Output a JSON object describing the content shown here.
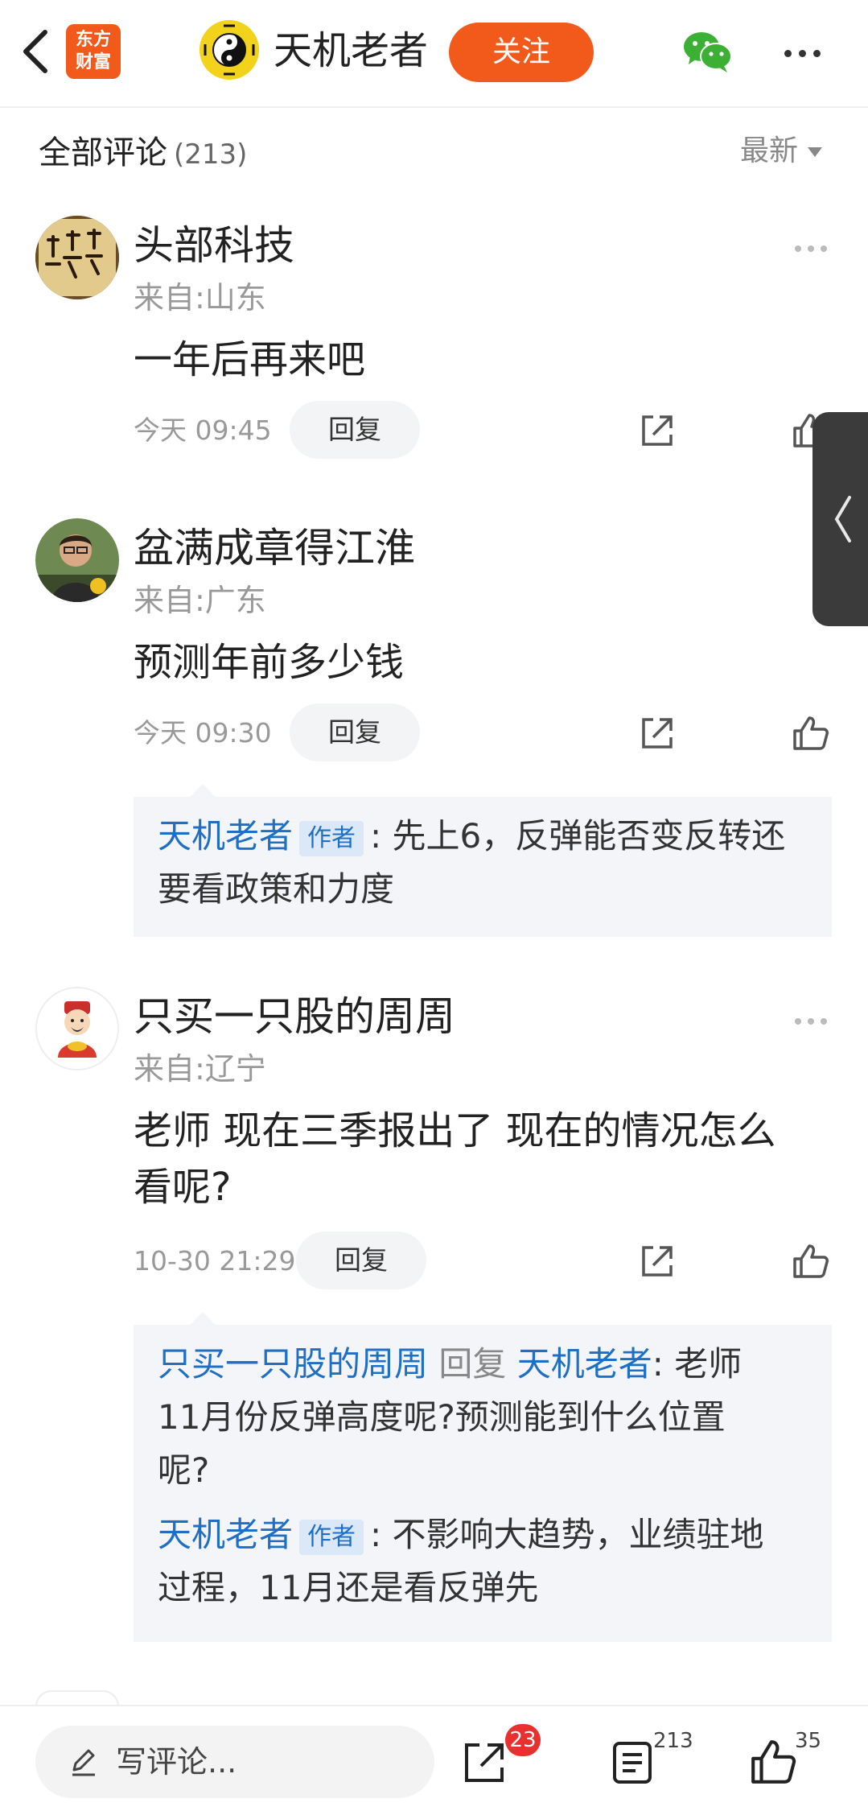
{
  "header": {
    "logo_text": "东方\n财富",
    "author_name": "天机老者",
    "follow_label": "关注"
  },
  "comments_header": {
    "title": "全部评论",
    "count": "(213)",
    "sort_label": "最新"
  },
  "comments": [
    {
      "name": "头部科技",
      "location": "来自:山东",
      "text": "一年后再来吧",
      "time": "今天 09:45",
      "reply_label": "回复"
    },
    {
      "name": "盆满成章得江淮",
      "location": "来自:广东",
      "text": "预测年前多少钱",
      "time": "今天 09:30",
      "reply_label": "回复",
      "replies": [
        {
          "author": "天机老者",
          "tag": "作者",
          "text": "先上6，反弹能否变反转还",
          "text_cont": "要看政策和力度"
        }
      ]
    },
    {
      "name": "只买一只股的周周",
      "location": "来自:辽宁",
      "text": "老师 现在三季报出了  现在的情况怎么",
      "text_cont": "看呢?",
      "time": "10-30 21:29",
      "reply_label": "回复",
      "replies": [
        {
          "author": "只买一只股的周周",
          "reply_word": "回复",
          "target": "天机老者",
          "text": "老师",
          "text_line2": "11月份反弹高度呢?预测能到什么位置",
          "text_line3": "呢?"
        },
        {
          "author": "天机老者",
          "tag": "作者",
          "text": "不影响大趋势，业绩驻地",
          "text_cont": "过程，11月还是看反弹先"
        }
      ]
    }
  ],
  "bottom_bar": {
    "write_placeholder": "写评论...",
    "share_badge": "23",
    "comment_count": "213",
    "like_count": "35"
  },
  "colors": {
    "accent": "#f25a1b",
    "link_blue": "#1f6fc5",
    "badge_red": "#e8302e"
  }
}
